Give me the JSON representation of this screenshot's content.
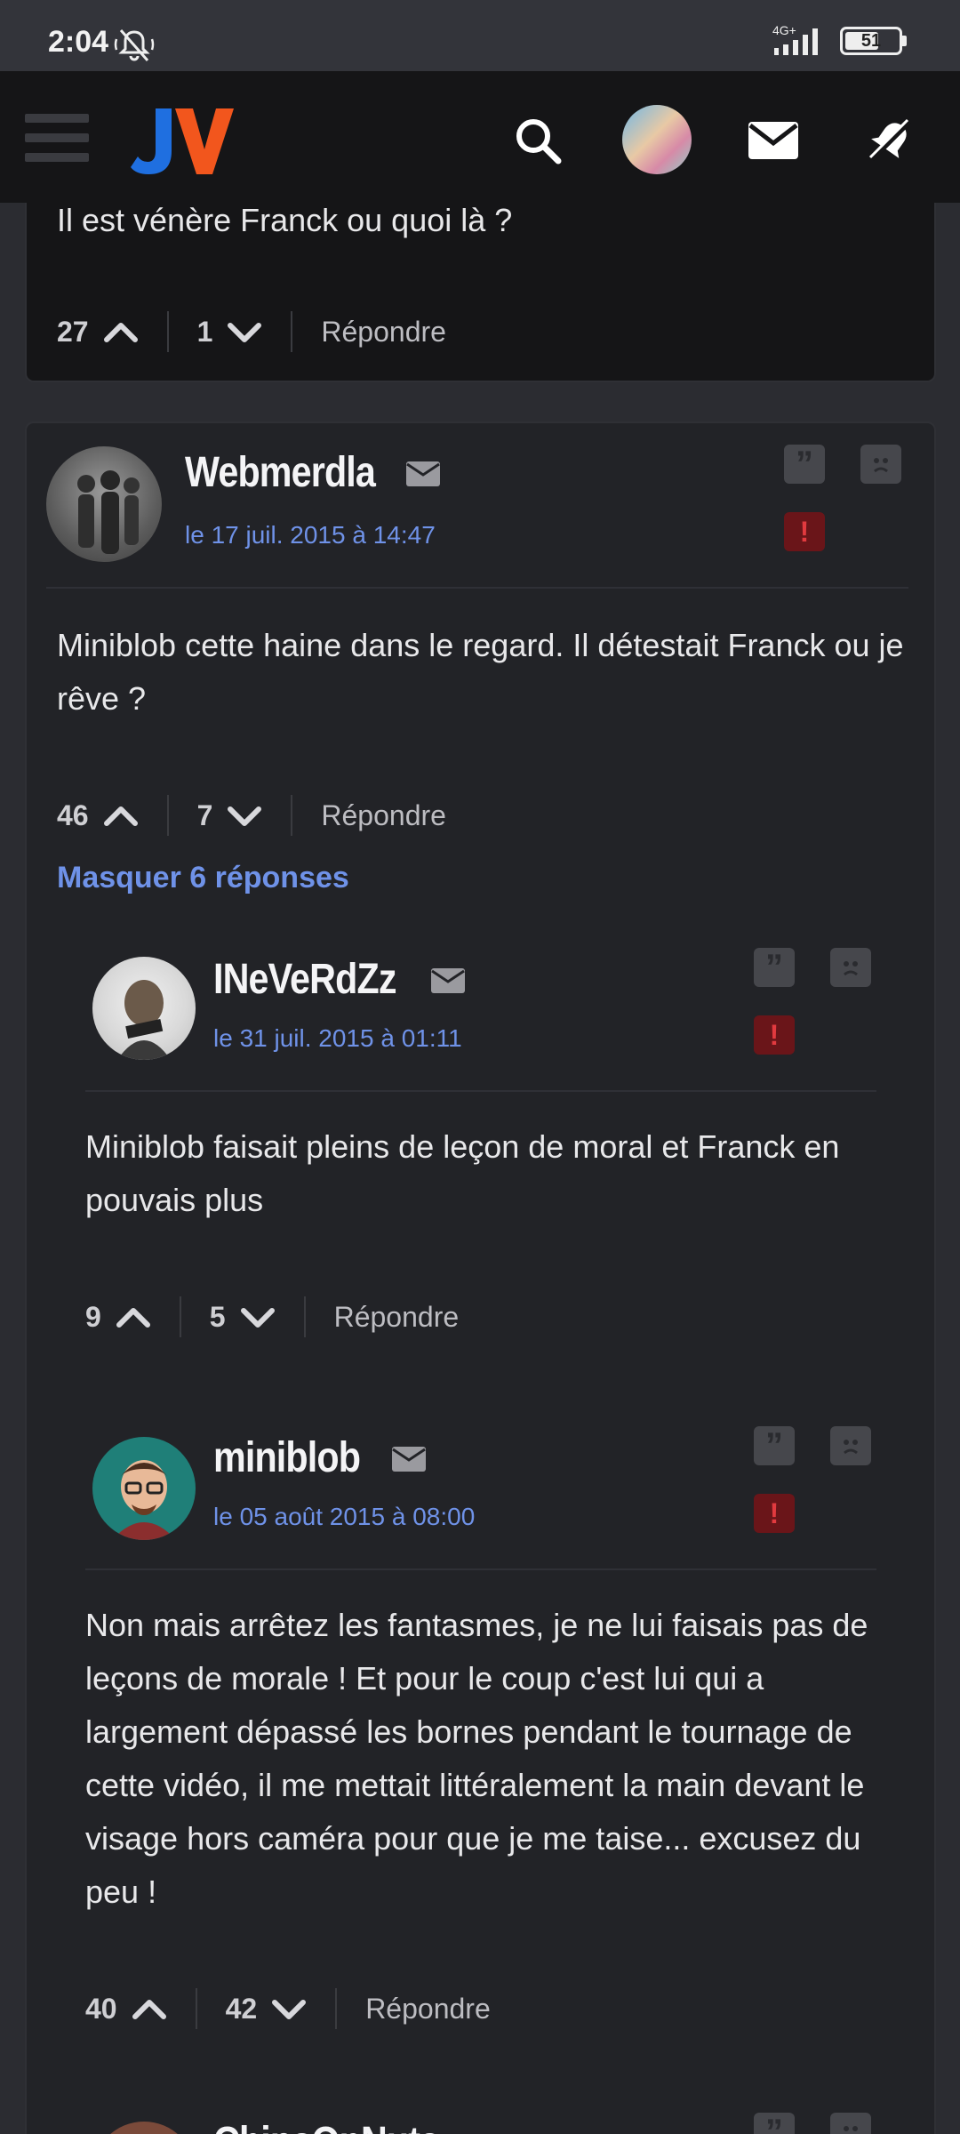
{
  "status_bar": {
    "time": "2:04",
    "network": "4G+",
    "battery": "51"
  },
  "header": {
    "logo_text": "JV",
    "menu_icon": "menu-icon",
    "search_icon": "search-icon",
    "mail_icon": "mail-icon",
    "bell_icon": "bell-off-icon"
  },
  "previous_comment": {
    "text": "Il est vénère Franck ou quoi là ?",
    "upvotes": "27",
    "downvotes": "1",
    "reply_label": "Répondre"
  },
  "main_comment": {
    "author": "Webmerdla",
    "date": "le 17 juil. 2015 à 14:47",
    "text": "Miniblob cette haine dans le regard. Il détestait Franck ou je rêve ?",
    "upvotes": "46",
    "downvotes": "7",
    "reply_label": "Répondre",
    "toggle_label": "Masquer 6 réponses"
  },
  "replies": [
    {
      "author": "INeVeRdZz",
      "date": "le 31 juil. 2015 à 01:11",
      "text": "Miniblob faisait pleins de leçon de moral et Franck en pouvais plus",
      "upvotes": "9",
      "downvotes": "5",
      "reply_label": "Répondre"
    },
    {
      "author": "miniblob",
      "date": "le 05 août 2015 à 08:00",
      "text": "Non mais arrêtez les fantasmes, je ne lui faisais pas de leçons de morale ! Et pour le coup c'est lui qui a largement dépassé les bornes pendant le tournage de cette vidéo, il me mettait littéralement la main devant le visage hors caméra pour que je me taise... excusez du peu !",
      "upvotes": "40",
      "downvotes": "42",
      "reply_label": "Répondre"
    },
    {
      "author": "ChipsOnNuts"
    }
  ],
  "icons": {
    "quote": "quote-icon",
    "sad": "sad-face-icon",
    "report": "alert-icon",
    "mail": "mail-icon"
  },
  "colors": {
    "accent": "#6f92e8",
    "report": "#6a1519",
    "logo_blue": "#1f6fe0",
    "logo_orange": "#f2561d"
  }
}
